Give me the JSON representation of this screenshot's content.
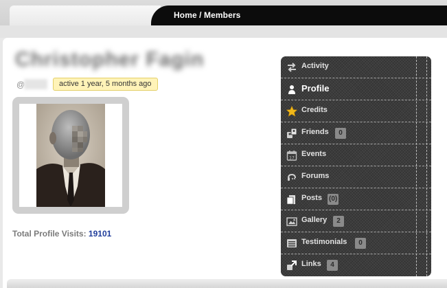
{
  "header": {
    "breadcrumb": "Home / Members"
  },
  "profile": {
    "name": "Christopher Fagin",
    "mention_prefix": "@",
    "activity": "active 1 year, 5 months ago",
    "visits_label": "Total Profile Visits:",
    "visits_count": "19101"
  },
  "nav": {
    "items": [
      {
        "label": "Activity",
        "icon": "activity-icon"
      },
      {
        "label": "Profile",
        "icon": "profile-icon",
        "active": true
      },
      {
        "label": "Credits",
        "icon": "star-icon"
      },
      {
        "label": "Friends",
        "icon": "friends-icon",
        "count": "0"
      },
      {
        "label": "Events",
        "icon": "calendar-icon"
      },
      {
        "label": "Forums",
        "icon": "forums-icon"
      },
      {
        "label": "Posts",
        "icon": "posts-icon",
        "count": "(0)"
      },
      {
        "label": "Gallery",
        "icon": "gallery-icon",
        "count": "2"
      },
      {
        "label": "Testimonials",
        "icon": "testimonials-icon",
        "count": "0"
      },
      {
        "label": "Links",
        "icon": "links-icon",
        "count": "4"
      }
    ]
  },
  "colors": {
    "nav_bg": "#3c3c3c",
    "badge_bg": "#fff3b8",
    "visits_count": "#1f3c9a",
    "star": "#f1b81a"
  }
}
